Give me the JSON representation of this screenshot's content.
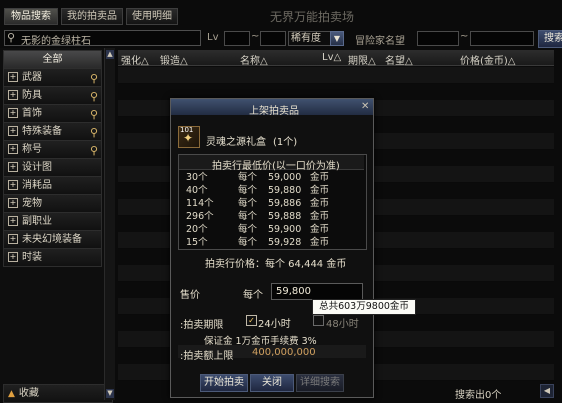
{
  "tabs": [
    {
      "label": "物品搜索"
    },
    {
      "label": "我的拍卖品"
    },
    {
      "label": "使用明细"
    }
  ],
  "window_title": "无界万能拍卖场",
  "search": {
    "placeholder": "无影的金绿柱石",
    "lv_label": "Lv",
    "rarity_label": "稀有度",
    "seller_label": "冒险家名望",
    "search_button": "搜索"
  },
  "columns": {
    "enhance": "强化△",
    "refine": "锻造△",
    "name": "名称△",
    "lv": "Lv△",
    "limit": "期限△",
    "reputation": "名望△",
    "price": "价格(金币)△"
  },
  "sidebar": {
    "items": [
      {
        "label": "全部",
        "has_search": false
      },
      {
        "label": "武器",
        "has_search": true
      },
      {
        "label": "防具",
        "has_search": true
      },
      {
        "label": "首饰",
        "has_search": true
      },
      {
        "label": "特殊装备",
        "has_search": true
      },
      {
        "label": "称号",
        "has_search": true
      },
      {
        "label": "设计图",
        "has_search": false
      },
      {
        "label": "消耗品",
        "has_search": false
      },
      {
        "label": "宠物",
        "has_search": false
      },
      {
        "label": "副职业",
        "has_search": false
      },
      {
        "label": "未央幻境装备",
        "has_search": false
      },
      {
        "label": "时装",
        "has_search": false
      }
    ],
    "favorites": "收藏"
  },
  "dialog": {
    "title": "上架拍卖品",
    "item_name": "灵魂之源礼盒",
    "item_count": "(1个)",
    "item_badge": "101",
    "list_header": "拍卖行最低价(以一口价为准)",
    "listings": [
      {
        "qty": "30个",
        "each": "每个",
        "price": "59,000",
        "unit": "金币"
      },
      {
        "qty": "40个",
        "each": "每个",
        "price": "59,880",
        "unit": "金币"
      },
      {
        "qty": "114个",
        "each": "每个",
        "price": "59,886",
        "unit": "金币"
      },
      {
        "qty": "296个",
        "each": "每个",
        "price": "59,888",
        "unit": "金币"
      },
      {
        "qty": "20个",
        "each": "每个",
        "price": "59,900",
        "unit": "金币"
      },
      {
        "qty": "15个",
        "each": "每个",
        "price": "59,928",
        "unit": "金币"
      }
    ],
    "market_price": "拍卖行价格：每个 64,444 金币",
    "sell_label": "售价",
    "each_label": "每个",
    "price_value": "59,800",
    "tooltip": "总共603万9800金币",
    "period_label": ":拍卖期限",
    "period_24": "24小时",
    "period_48": "48小时",
    "deposit": "保证金  1万金币手续费  3%",
    "limit_label": ":拍卖额上限",
    "limit_value": "400,000,000",
    "buttons": {
      "start": "开始拍卖",
      "close": "关闭",
      "detail": "详细搜索"
    }
  },
  "footer": {
    "results": "搜索出0个"
  }
}
